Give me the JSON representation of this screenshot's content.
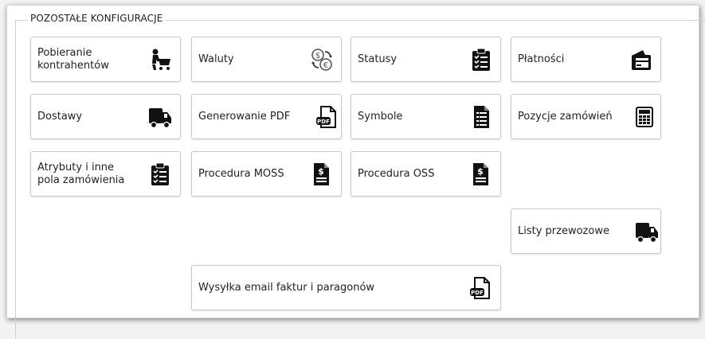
{
  "section": {
    "title": "POZOSTAŁE KONFIGURACJE"
  },
  "tiles": {
    "pobieranie": {
      "label": "Pobieranie\nkontrahentów",
      "icon": "person-cart-icon"
    },
    "waluty": {
      "label": "Waluty",
      "icon": "currency-exchange-icon"
    },
    "statusy": {
      "label": "Statusy",
      "icon": "clipboard-checklist-icon"
    },
    "platnosci": {
      "label": "Płatności",
      "icon": "wallet-icon"
    },
    "dostawy": {
      "label": "Dostawy",
      "icon": "delivery-truck-icon"
    },
    "pdf": {
      "label": "Generowanie PDF",
      "icon": "pdf-file-icon"
    },
    "symbole": {
      "label": "Symbole",
      "icon": "document-list-icon"
    },
    "pozycje": {
      "label": "Pozycje zamówień",
      "icon": "calculator-icon"
    },
    "atrybuty": {
      "label": "Atrybuty i inne\npola zamówienia",
      "icon": "clipboard-checklist-icon"
    },
    "moss": {
      "label": "Procedura MOSS",
      "icon": "dollar-document-icon"
    },
    "oss": {
      "label": "Procedura OSS",
      "icon": "dollar-document-icon"
    },
    "listy": {
      "label": "Listy przewozowe",
      "icon": "delivery-truck-icon"
    },
    "wysylka": {
      "label": "Wysyłka email faktur i paragonów",
      "icon": "pdf-file-icon"
    }
  }
}
